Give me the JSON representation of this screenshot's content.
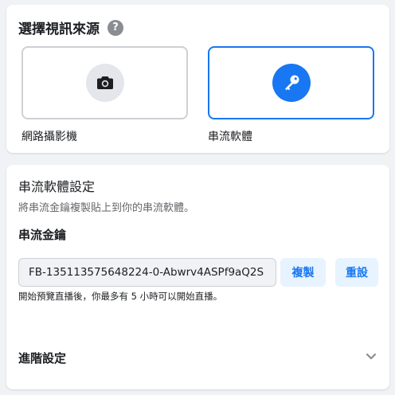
{
  "source": {
    "title": "選擇視訊來源",
    "help_icon": "question-mark-icon",
    "options": [
      {
        "label": "網路攝影機",
        "icon": "camera-icon",
        "selected": false
      },
      {
        "label": "串流軟體",
        "icon": "key-icon",
        "selected": true
      }
    ]
  },
  "settings": {
    "title": "串流軟體設定",
    "description": "將串流金鑰複製貼上到你的串流軟體。",
    "key_heading": "串流金鑰",
    "stream_key": "FB-135113575648224-0-Abwrv4ASPf9aQ2S",
    "copy_label": "複製",
    "reset_label": "重設",
    "hint": "開始預覽直播後，你最多有 5 小時可以開始直播。",
    "advanced_label": "進階設定",
    "advanced_icon": "chevron-down-icon"
  },
  "colors": {
    "accent": "#1877f2",
    "light_accent": "#e7f3ff",
    "page_background": "#f0f2f5"
  }
}
